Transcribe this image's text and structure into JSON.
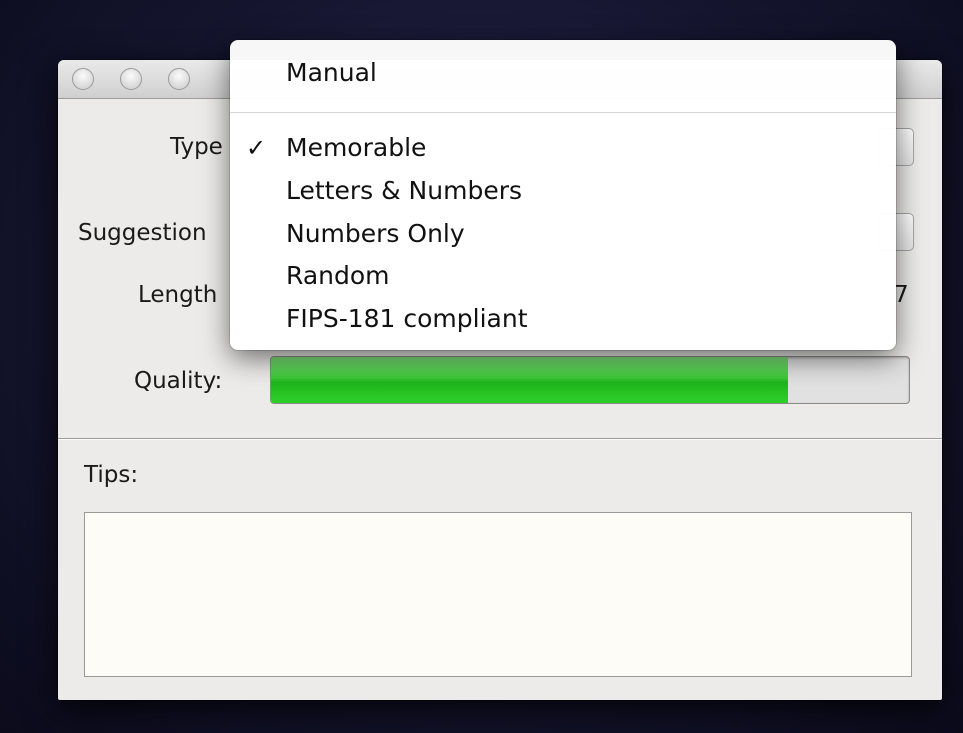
{
  "form": {
    "type_label": "Type",
    "suggestion_label": "Suggestion",
    "length_label": "Length",
    "length_value_partial": "7",
    "quality_label": "Quality:",
    "quality_fraction": 0.81,
    "tips_label": "Tips:",
    "tips_text": ""
  },
  "type_menu": {
    "items": [
      {
        "label": "Manual",
        "checked": false
      },
      {
        "label": "Memorable",
        "checked": true
      },
      {
        "label": "Letters & Numbers",
        "checked": false
      },
      {
        "label": "Numbers Only",
        "checked": false
      },
      {
        "label": "Random",
        "checked": false
      },
      {
        "label": "FIPS-181 compliant",
        "checked": false
      }
    ],
    "checkmark": "✓"
  }
}
